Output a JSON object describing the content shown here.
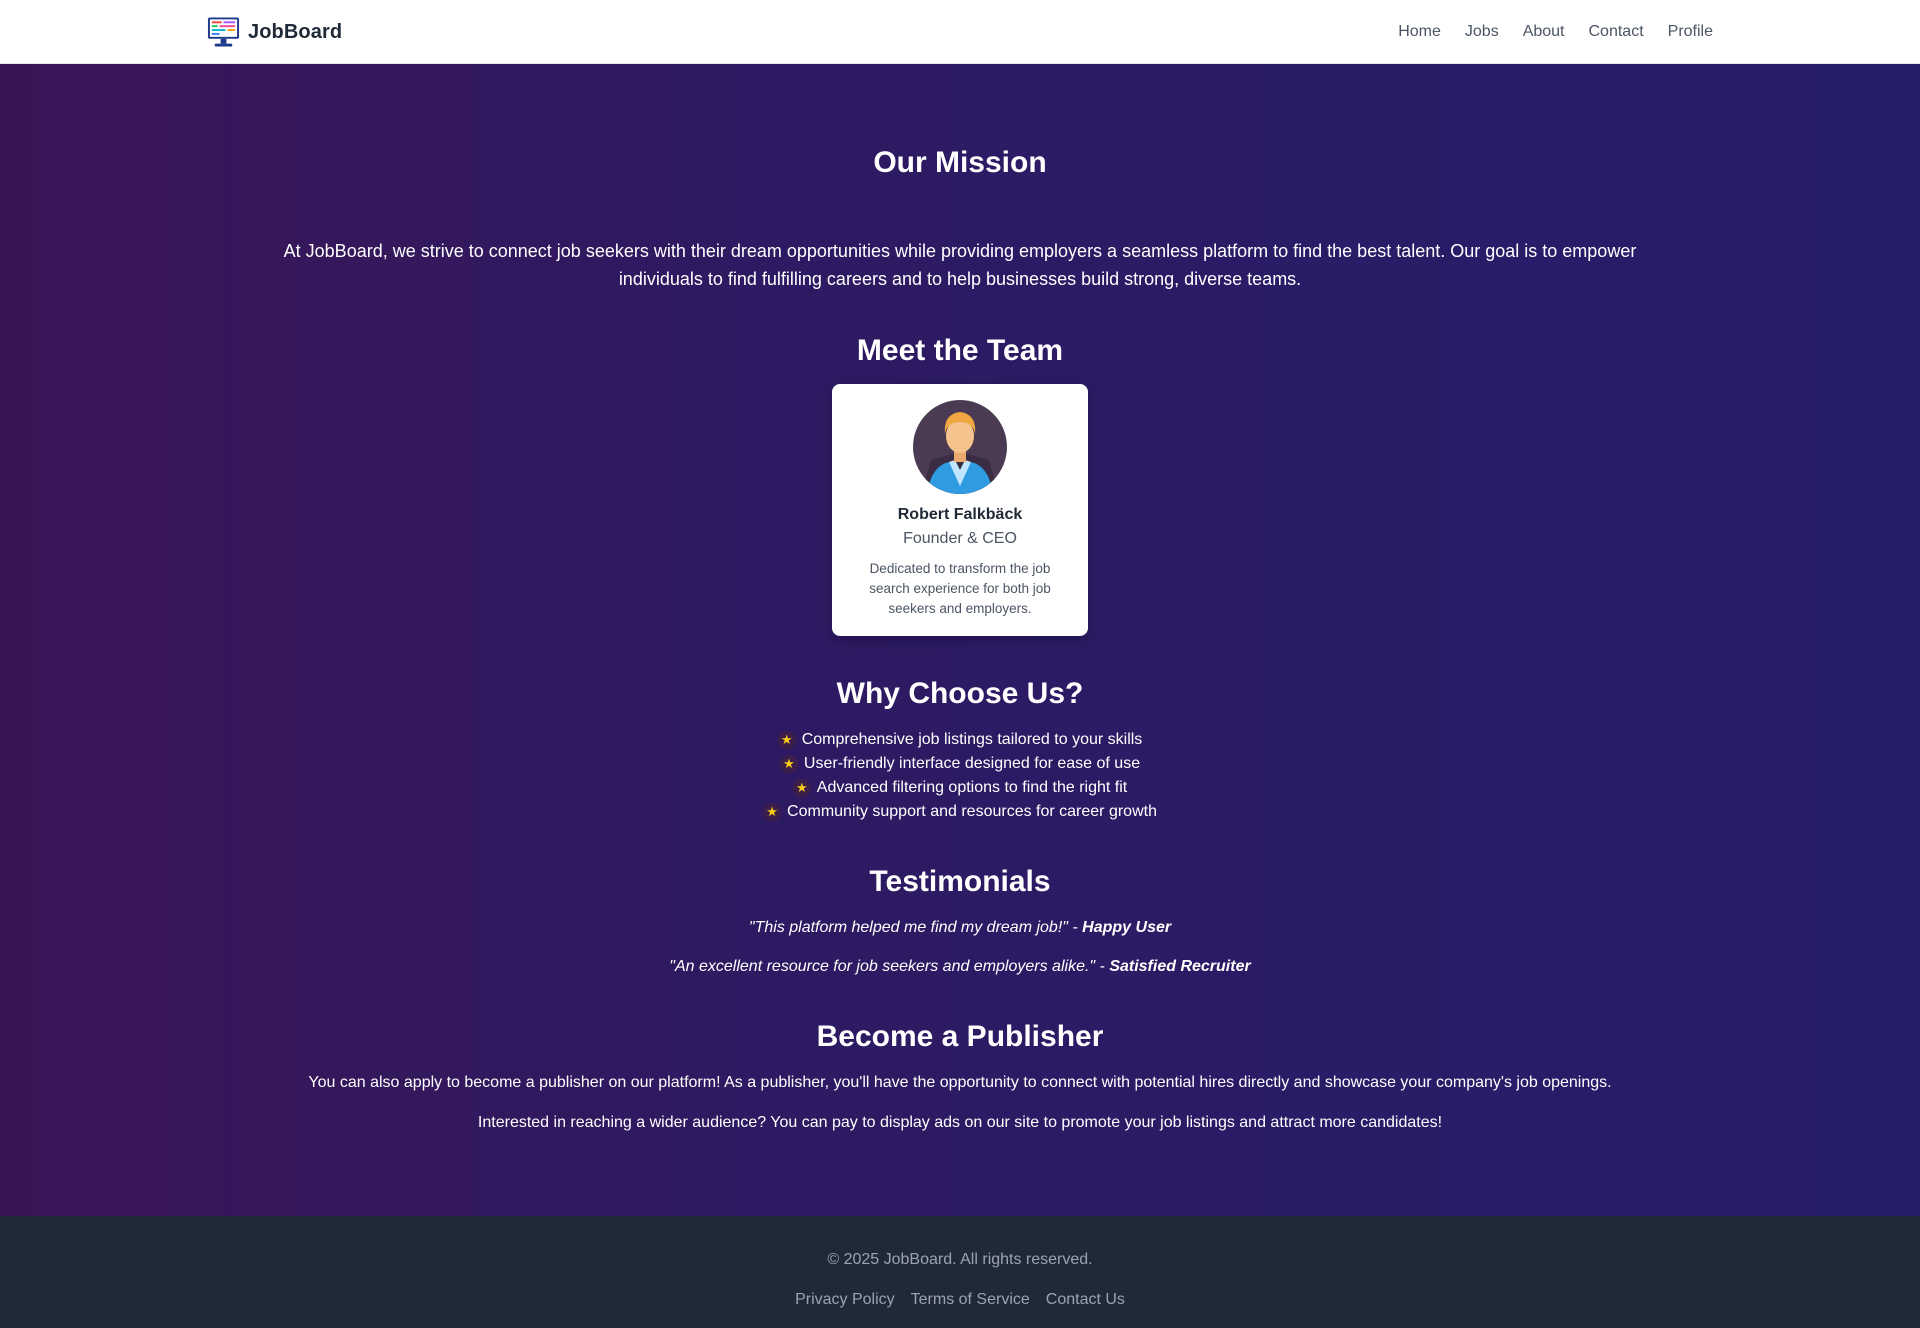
{
  "navbar": {
    "brand": "JobBoard",
    "logo_icon": "computer-monitor-icon",
    "links": [
      "Home",
      "Jobs",
      "About",
      "Contact",
      "Profile"
    ]
  },
  "mission": {
    "title": "Our Mission",
    "text": "At JobBoard, we strive to connect job seekers with their dream opportunities while providing employers a seamless platform to find the best talent. Our goal is to empower individuals to find fulfilling careers and to help businesses build strong, diverse teams."
  },
  "team": {
    "title": "Meet the Team",
    "members": [
      {
        "name": "Robert Falkbäck",
        "role": "Founder & CEO",
        "bio": "Dedicated to transform the job search experience for both job seekers and employers.",
        "avatar_icon": "person-avatar-icon"
      }
    ]
  },
  "why": {
    "title": "Why Choose Us?",
    "bullet_icon": "star-icon",
    "items": [
      "Comprehensive job listings tailored to your skills",
      "User-friendly interface designed for ease of use",
      "Advanced filtering options to find the right fit",
      "Community support and resources for career growth"
    ]
  },
  "testimonials": {
    "title": "Testimonials",
    "items": [
      {
        "quote": "\"This platform helped me find my dream job!\"",
        "separator": " - ",
        "author": "Happy User"
      },
      {
        "quote": "\"An excellent resource for job seekers and employers alike.\"",
        "separator": " - ",
        "author": "Satisfied Recruiter"
      }
    ]
  },
  "publisher": {
    "title": "Become a Publisher",
    "paragraphs": [
      "You can also apply to become a publisher on our platform! As a publisher, you'll have the opportunity to connect with potential hires directly and showcase your company's job openings.",
      "Interested in reaching a wider audience? You can pay to display ads on our site to promote your job listings and attract more candidates!"
    ]
  },
  "footer": {
    "copyright": "© 2025 JobBoard. All rights reserved.",
    "links": [
      "Privacy Policy",
      "Terms of Service",
      "Contact Us"
    ]
  },
  "colors": {
    "gradient_start": "#3a1556",
    "gradient_end": "#261d6b",
    "footer_bg": "#1f2937",
    "star": "#facc15"
  }
}
